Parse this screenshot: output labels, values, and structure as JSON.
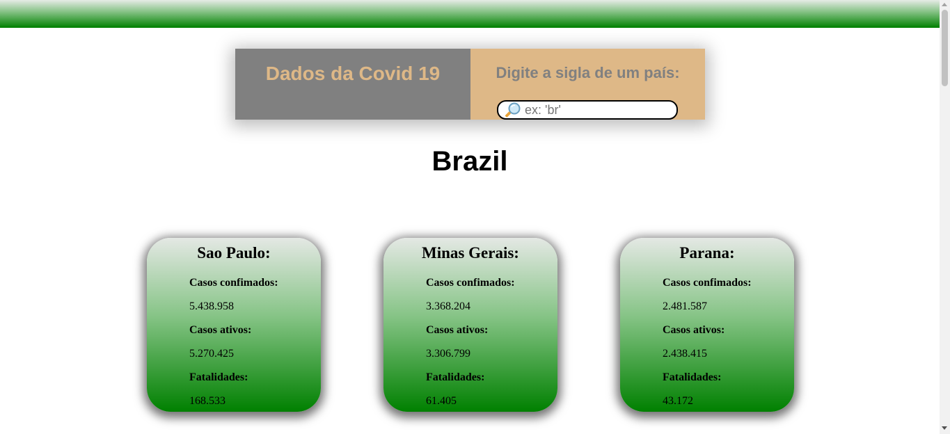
{
  "header": {
    "title": "Dados da Covid 19",
    "search_prompt": "Digite a sigla de um país:",
    "search_icon": "magnifying-glass-icon",
    "search_placeholder": "ex: 'br'",
    "search_value": ""
  },
  "country": "Brazil",
  "states": [
    {
      "name": "Sao Paulo:",
      "confirmed_label": "Casos confimados:",
      "confirmed": "5.438.958",
      "active_label": "Casos ativos:",
      "active": "5.270.425",
      "deaths_label": "Fatalidades:",
      "deaths": "168.533"
    },
    {
      "name": "Minas Gerais:",
      "confirmed_label": "Casos confimados:",
      "confirmed": "3.368.204",
      "active_label": "Casos ativos:",
      "active": "3.306.799",
      "deaths_label": "Fatalidades:",
      "deaths": "61.405"
    },
    {
      "name": "Parana:",
      "confirmed_label": "Casos confimados:",
      "confirmed": "2.481.587",
      "active_label": "Casos ativos:",
      "active": "2.438.415",
      "deaths_label": "Fatalidades:",
      "deaths": "43.172"
    }
  ],
  "colors": {
    "top_bar": "#008000",
    "header_left_bg": "#808080",
    "header_right_bg": "#deb887",
    "card_gradient_top": "#e4e8e4",
    "card_gradient_bottom": "#008000"
  }
}
